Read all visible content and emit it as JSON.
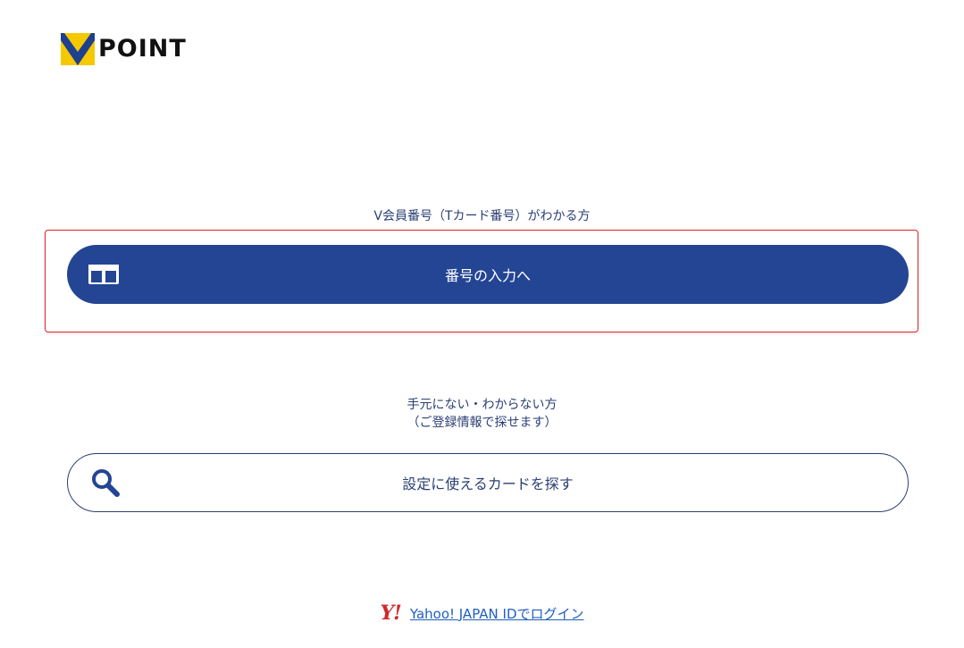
{
  "header": {
    "logo_text": "POINT"
  },
  "member_number_section": {
    "caption": "V会員番号（Tカード番号）がわかる方",
    "button_label": "番号の入力へ",
    "button_icon": "card-icon"
  },
  "search_section": {
    "caption_line1": "手元にない・わからない方",
    "caption_line2": "（ご登録情報で探せます）",
    "button_label": "設定に使えるカードを探す",
    "button_icon": "search-icon"
  },
  "footer": {
    "yahoo_logo": "Y!",
    "login_link": "Yahoo! JAPAN IDでログイン"
  },
  "colors": {
    "primary": "#244594",
    "text": "#2b3f73",
    "highlight_border": "#e0242b",
    "logo_yellow": "#f5c800",
    "logo_blue": "#1f3f8f",
    "yahoo_red": "#cc2b2b",
    "link": "#1f5fbf"
  }
}
